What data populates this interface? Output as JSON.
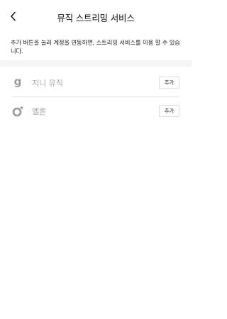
{
  "header": {
    "title": "뮤직 스트리밍 서비스",
    "back_icon": "chevron-left-icon"
  },
  "notice": {
    "text": "추가 버튼을 눌러 계정을 연동하면, 스트리밍 서비스를 이용 할 수 있습니다."
  },
  "services": [
    {
      "name": "지니 뮤직",
      "icon": "genie-music-icon",
      "add_label": "추가"
    },
    {
      "name": "멜론",
      "icon": "melon-icon",
      "add_label": "추가"
    }
  ],
  "colors": {
    "icon_gray": "#9a9a9a",
    "label_gray": "#a8a8a8",
    "divider": "#e6e6e6",
    "section_gap": "#f5f5f5"
  }
}
